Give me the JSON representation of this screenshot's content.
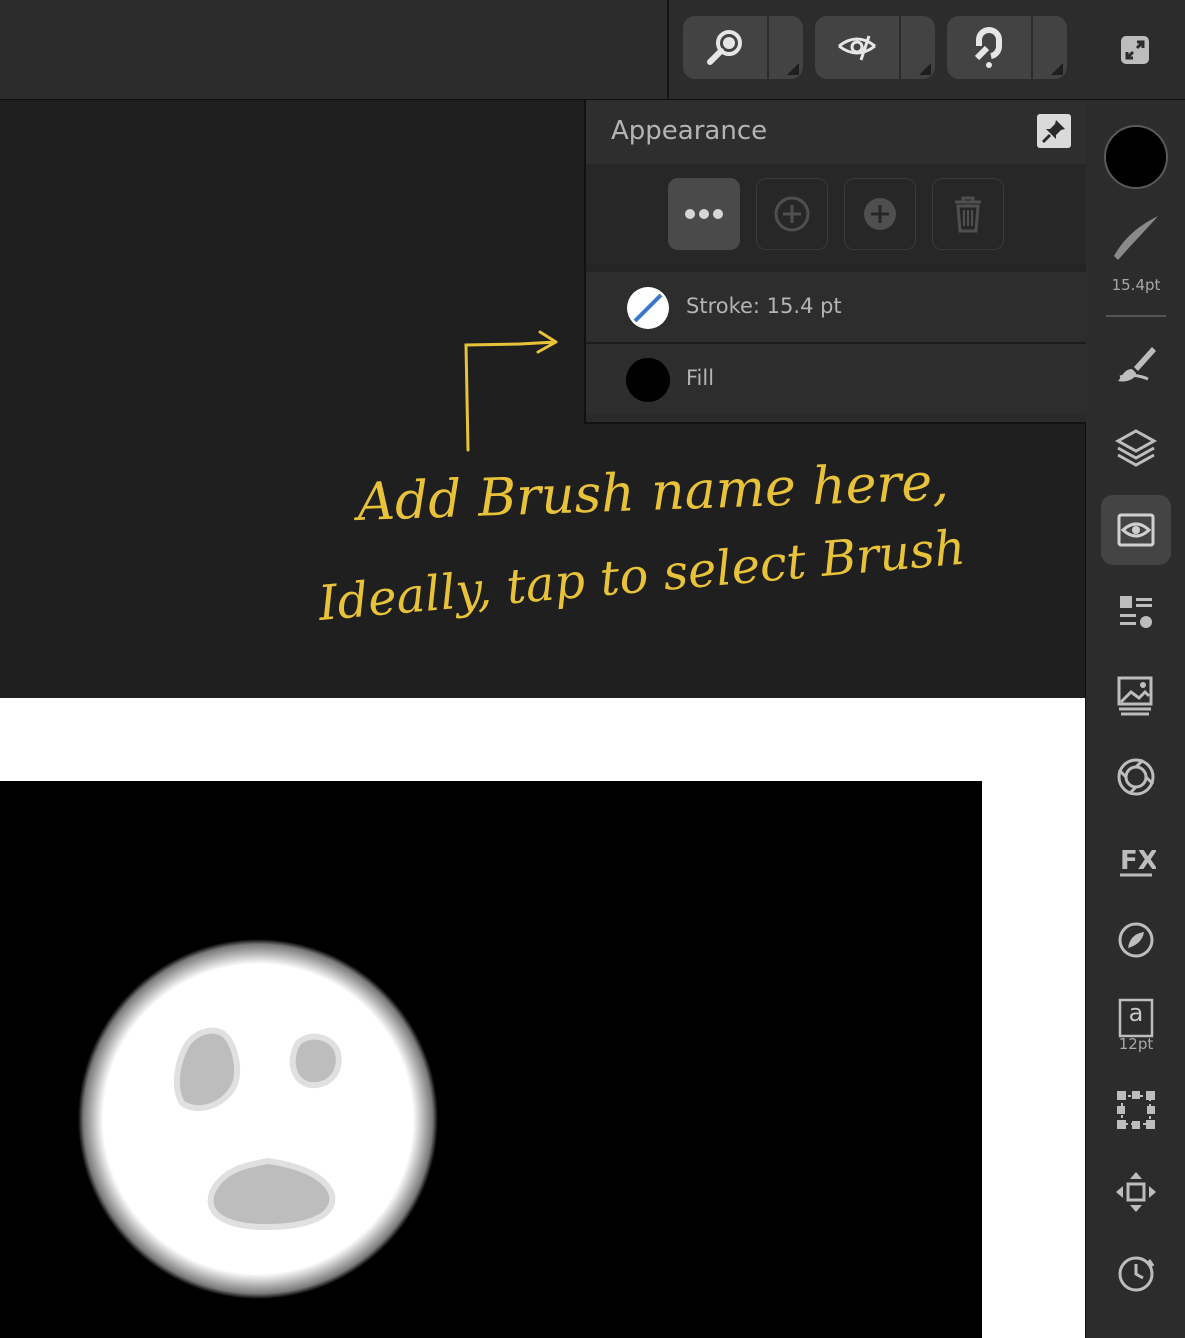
{
  "toolbar": {
    "tools": [
      {
        "name": "zoom-tool",
        "icon": "magnifier-icon"
      },
      {
        "name": "view-tool",
        "icon": "wiper-eye-icon"
      },
      {
        "name": "snapping-tool",
        "icon": "magnet-icon"
      }
    ],
    "fullscreen_icon": "fullscreen-icon"
  },
  "appearance_panel": {
    "title": "Appearance",
    "actions": [
      "more-icon",
      "add-outline-icon",
      "add-filled-icon",
      "trash-icon"
    ],
    "rows": [
      {
        "label": "Stroke: 15.4 pt",
        "icon": "stroke-swatch-icon"
      },
      {
        "label": "Fill",
        "icon": "fill-swatch-icon",
        "color": "#000000"
      }
    ]
  },
  "sidebar": {
    "color": "#000000",
    "brush_width_label": "15.4pt",
    "text_size_label": "12pt",
    "text_glyph": "a"
  },
  "annotation": {
    "line1": "Add Brush name here,",
    "line2": "Ideally, tap to select Brush",
    "color": "#e8c33a"
  },
  "colors": {
    "accent_stroke": "#3a78c8",
    "panel": "#2a2a2a",
    "toolbar": "#2c2c2c"
  }
}
